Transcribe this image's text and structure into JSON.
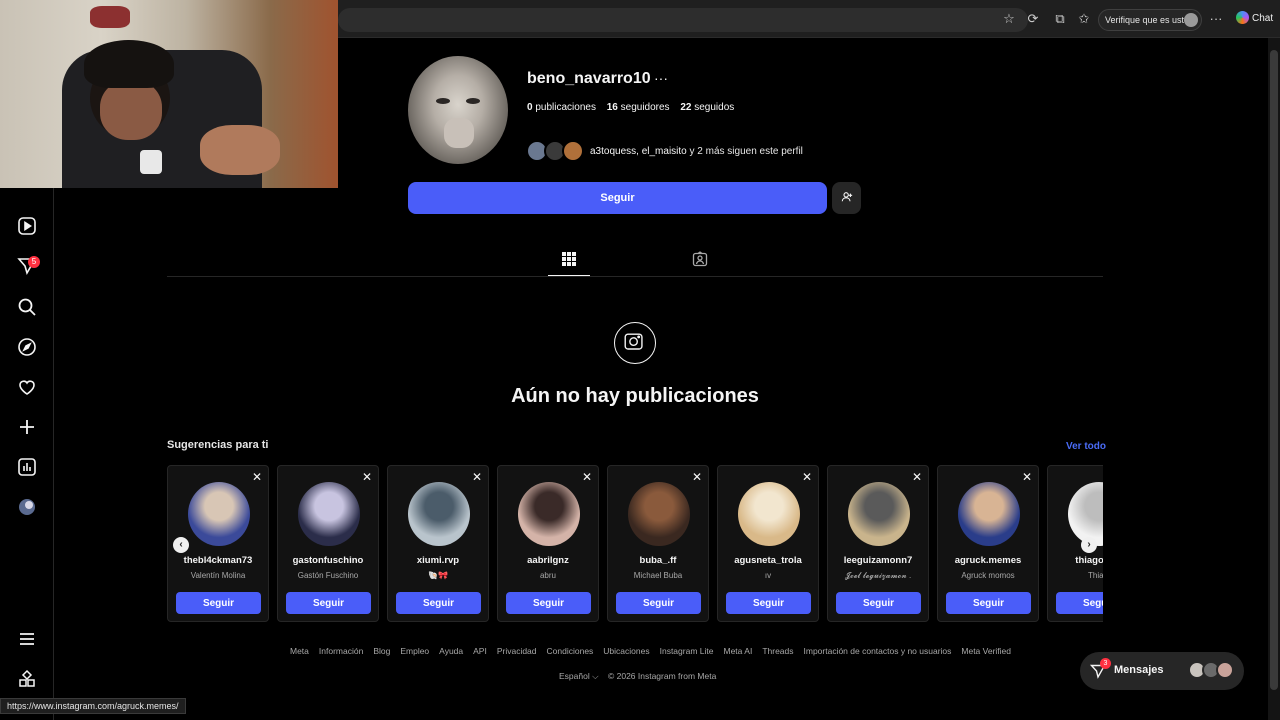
{
  "browser": {
    "verify_label": "Verifique que es usted",
    "chat_label": "Chat"
  },
  "nav": {
    "notifications_badge": "5"
  },
  "profile": {
    "username": "beno_navarro10",
    "more": "···",
    "posts_count": "0",
    "posts_label": "publicaciones",
    "followers_count": "16",
    "followers_label": "seguidores",
    "following_count": "22",
    "following_label": "seguidos",
    "followed_by_names": "a3toquess, el_maisito",
    "followed_by_rest": "y 2 más siguen este perfil",
    "follow_button": "Seguir"
  },
  "empty_state": {
    "title": "Aún no hay publicaciones"
  },
  "suggestions": {
    "title": "Sugerencias para ti",
    "see_all": "Ver todo",
    "follow_label": "Seguir",
    "cards": [
      {
        "username": "thebl4ckman73",
        "name": "Valentín Molina",
        "color1": "#3b4a9a",
        "color2": "#d8c6b5"
      },
      {
        "username": "gastonfuschino",
        "name": "Gastón Fuschino",
        "color1": "#2b2d4a",
        "color2": "#c8c4e0"
      },
      {
        "username": "xiumi.rvp",
        "name": "🐚🎀",
        "color1": "#b9c4cc",
        "color2": "#4b5c6a"
      },
      {
        "username": "aabrilgnz",
        "name": "abru",
        "color1": "#d4b3a8",
        "color2": "#3a2a28"
      },
      {
        "username": "buba_.ff",
        "name": "Michael Buba",
        "color1": "#3a2820",
        "color2": "#8a5a3c"
      },
      {
        "username": "agusneta_trola",
        "name": "ıv",
        "color1": "#d9b989",
        "color2": "#f2e6cf"
      },
      {
        "username": "leeguizamonn7",
        "name": "𝓙𝓸𝓮𝓵 𝓵𝓮𝓰𝓾𝓲𝔃𝓪𝓶𝓸𝓷 .",
        "color1": "#c9b48c",
        "color2": "#5a5a5a"
      },
      {
        "username": "agruck.memes",
        "name": "Agruck momos",
        "color1": "#2a3d8a",
        "color2": "#d8b494"
      },
      {
        "username": "thiagooo_",
        "name": "Thiag",
        "color1": "#f2f2f2",
        "color2": "#bdbdbd"
      }
    ]
  },
  "footer": {
    "links": [
      "Meta",
      "Información",
      "Blog",
      "Empleo",
      "Ayuda",
      "API",
      "Privacidad",
      "Condiciones",
      "Ubicaciones",
      "Instagram Lite",
      "Meta AI",
      "Threads",
      "Importación de contactos y no usuarios",
      "Meta Verified"
    ],
    "language": "Español ⌵",
    "copyright": "© 2026 Instagram from Meta"
  },
  "messages": {
    "label": "Mensajes",
    "badge": "3"
  },
  "status_bar": {
    "url": "https://www.instagram.com/agruck.memes/"
  }
}
